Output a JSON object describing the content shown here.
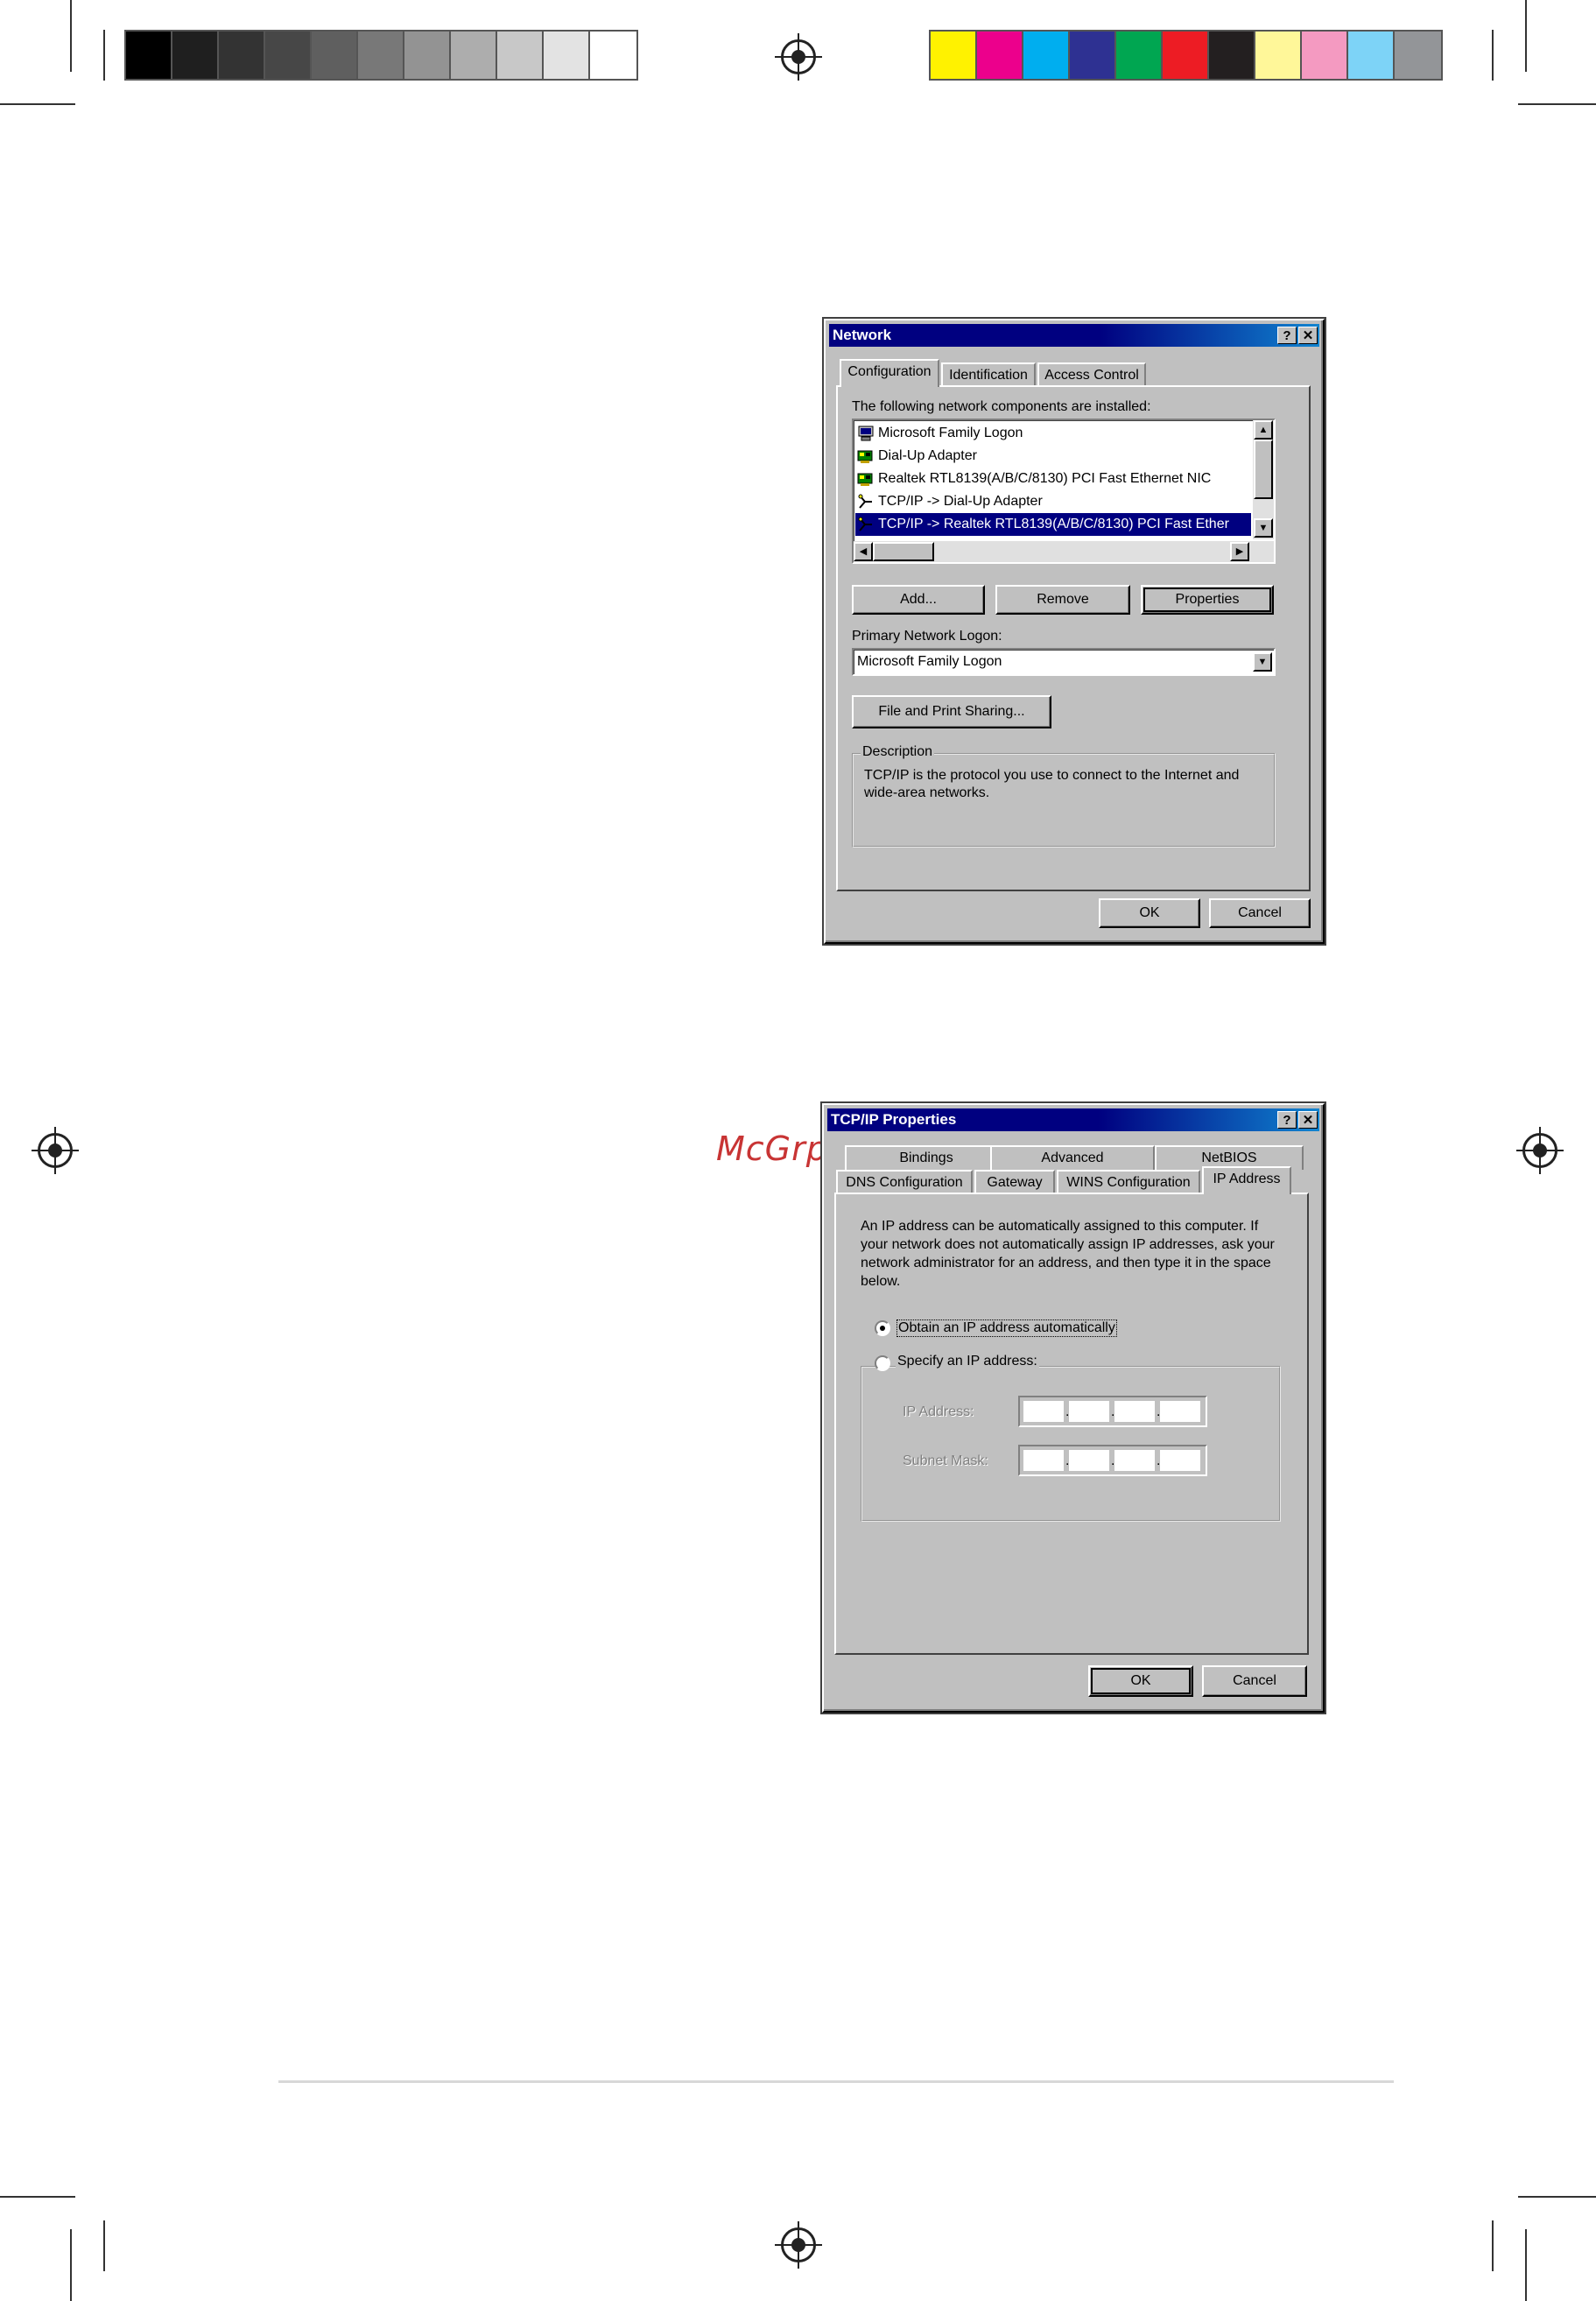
{
  "print_marks": {
    "gray_swatches": [
      "#000000",
      "#1f1f1f",
      "#333333",
      "#474747",
      "#5f5f5f",
      "#787878",
      "#939393",
      "#adadad",
      "#c8c8c8",
      "#e3e3e3",
      "#ffffff"
    ],
    "color_swatches": [
      "#fff200",
      "#ec008c",
      "#00aeef",
      "#2e3192",
      "#00a651",
      "#ed1c24",
      "#231f20",
      "#fff799",
      "#f49ac1",
      "#7dd3f7",
      "#939598"
    ]
  },
  "watermark": "McGrp.Ru",
  "network_dialog": {
    "title": "Network",
    "help_button": "?",
    "close_button": "✕",
    "tabs": [
      "Configuration",
      "Identification",
      "Access Control"
    ],
    "components_label": "The following network components are installed:",
    "components": [
      {
        "label": "Microsoft Family Logon",
        "icon": "client-icon"
      },
      {
        "label": "Dial-Up Adapter",
        "icon": "adapter-icon"
      },
      {
        "label": "Realtek RTL8139(A/B/C/8130) PCI Fast Ethernet NIC",
        "icon": "adapter-icon"
      },
      {
        "label": "TCP/IP -> Dial-Up Adapter",
        "icon": "protocol-icon"
      },
      {
        "label": "TCP/IP -> Realtek RTL8139(A/B/C/8130) PCI Fast Ether",
        "icon": "protocol-icon",
        "selected": true
      }
    ],
    "add_label": "Add...",
    "remove_label": "Remove",
    "properties_label": "Properties",
    "primary_logon_label": "Primary Network Logon:",
    "primary_logon_value": "Microsoft Family Logon",
    "file_sharing_label": "File and Print Sharing...",
    "description_legend": "Description",
    "description_text": "TCP/IP is the protocol you use to connect to the Internet and wide-area networks.",
    "ok_label": "OK",
    "cancel_label": "Cancel"
  },
  "tcpip_dialog": {
    "title": "TCP/IP Properties",
    "help_button": "?",
    "close_button": "✕",
    "tabs_back": [
      "Bindings",
      "Advanced",
      "NetBIOS"
    ],
    "tabs_front": [
      "DNS Configuration",
      "Gateway",
      "WINS Configuration",
      "IP Address"
    ],
    "intro_text": "An IP address can be automatically assigned to this computer. If your network does not automatically assign IP addresses, ask your network administrator for an address, and then type it in the space below.",
    "obtain_label": "Obtain an IP address automatically",
    "specify_label": "Specify an IP address:",
    "ip_address_label": "IP Address:",
    "subnet_mask_label": "Subnet Mask:",
    "ip_dot": ".",
    "ok_label": "OK",
    "cancel_label": "Cancel"
  }
}
